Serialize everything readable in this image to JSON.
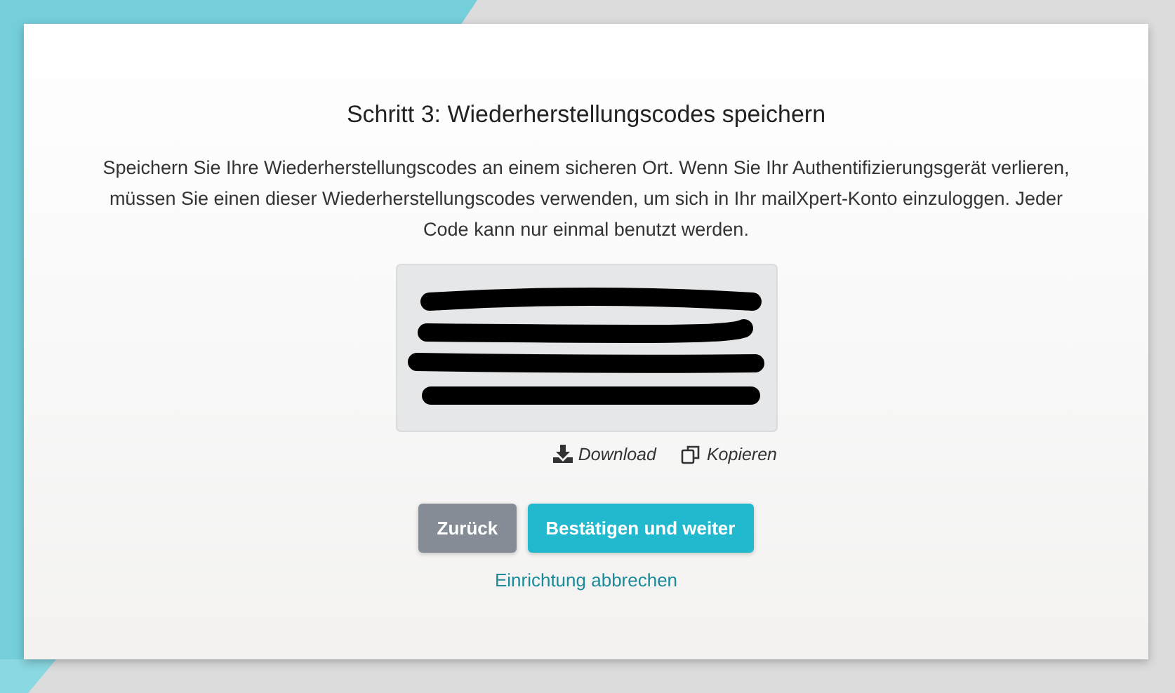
{
  "title": "Schritt 3: Wiederherstellungscodes speichern",
  "description": "Speichern Sie Ihre Wiederherstellungscodes an einem sicheren Ort. Wenn Sie Ihr Authentifizierungsgerät verlieren, müssen Sie einen dieser Wiederherstellungscodes verwenden, um sich in Ihr mailXpert-Konto einzuloggen. Jeder Code kann nur einmal benutzt werden.",
  "codes_box": {
    "redacted": true
  },
  "code_actions": [
    {
      "kind": "download",
      "label": "Download"
    },
    {
      "kind": "copy",
      "label": "Kopieren"
    }
  ],
  "buttons": [
    {
      "kind": "secondary",
      "label": "Zurück"
    },
    {
      "kind": "primary",
      "label": "Bestätigen und weiter"
    }
  ],
  "cancel_link": "Einrichtung abbrechen"
}
